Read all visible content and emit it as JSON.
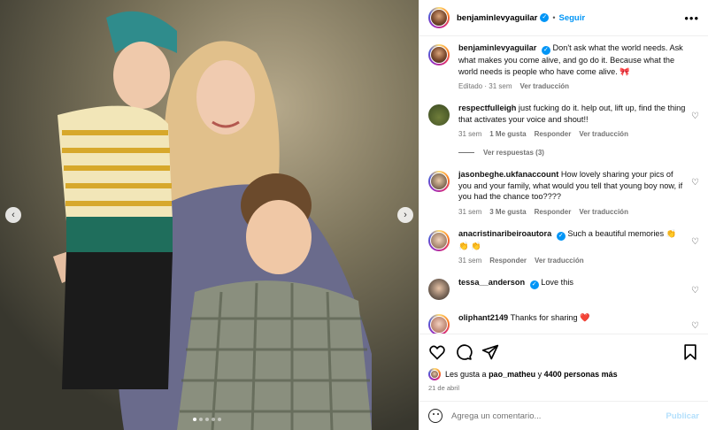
{
  "post": {
    "author": "benjaminlevyaguilar",
    "follow_label": "Seguir",
    "separator": "•",
    "more_label": "•••",
    "image_alt": "Family photo: young boy in striped shirt, woman with long blonde hair and boy in plaid shirt",
    "nav": {
      "prev": "‹",
      "next": "›"
    },
    "carousel_dots": 5,
    "active_dot": 0
  },
  "caption": {
    "user": "benjaminlevyaguilar",
    "text": "Don't ask what the world needs. Ask what makes you come alive, and go do it. Because what the world needs is people who have come alive. 🎀",
    "edited": "Editado · 31 sem",
    "translate": "Ver traducción"
  },
  "comments": [
    {
      "user": "respectfulleigh",
      "verified": false,
      "text": "just fucking do it. help out, lift up, find the thing that activates your voice and shout!!",
      "time": "31 sem",
      "likes": "1 Me gusta",
      "reply": "Responder",
      "translate": "Ver traducción",
      "replies": "Ver respuestas (3)"
    },
    {
      "user": "jasonbeghe.ukfanaccount",
      "verified": false,
      "text": "How lovely sharing your pics of you and your family, what would you tell that young boy now, if you had the chance too????",
      "time": "31 sem",
      "likes": "3 Me gusta",
      "reply": "Responder",
      "translate": "Ver traducción"
    },
    {
      "user": "anacristinaribeiroautora",
      "verified": true,
      "text": "Such a beautiful memories 👏 👏 👏",
      "time": "31 sem",
      "reply": "Responder",
      "translate": "Ver traducción"
    },
    {
      "user": "tessa__anderson",
      "verified": true,
      "text": "Love this"
    },
    {
      "user": "oliphant2149",
      "verified": false,
      "text": "Thanks for sharing ❤️"
    }
  ],
  "likes": {
    "prefix": "Les gusta a",
    "user": "pao_matheu",
    "joiner": "y",
    "count": "4400 personas más",
    "date": "21 de abril"
  },
  "add_comment": {
    "placeholder": "Agrega un comentario...",
    "publish": "Publicar"
  },
  "icons": [
    "heart-icon",
    "comment-icon",
    "share-icon",
    "bookmark-icon",
    "emoji-icon",
    "more-icon",
    "verified-icon"
  ],
  "colors": {
    "link": "#0095f6",
    "muted": "#737373",
    "publish_disabled": "#b2dffc"
  }
}
